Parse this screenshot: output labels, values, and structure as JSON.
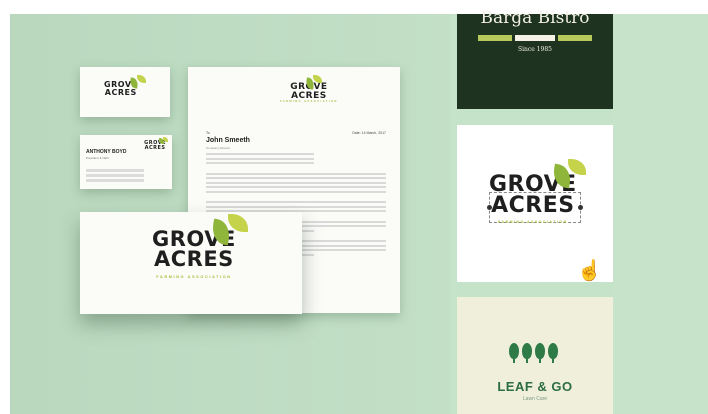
{
  "brand": {
    "name_line1": "GROVE",
    "name_line2": "ACRES",
    "tagline": "FARMING ASSOCIATION"
  },
  "business_card_back": {
    "name": "ANTHONY BOYD",
    "title": "President & CEO"
  },
  "letterhead": {
    "to_label": "To",
    "date": "Date: 14 March, 2017",
    "recipient": "John Smeeth",
    "recipient_role": "Company Director"
  },
  "templates": [
    {
      "title": "Barga Bistro",
      "subtitle": "Since 1985"
    },
    {
      "title": "GROVE ACRES"
    },
    {
      "title": "LEAF & GO",
      "subtitle": "Lawn Care"
    }
  ],
  "colors": {
    "background": "#c5e3c9",
    "leaf_light": "#c4d34a",
    "leaf_dark": "#8fb53a",
    "bistro_bg": "#1e3320",
    "leafgo_green": "#2e7b48"
  },
  "icons": {
    "cursor": "pointer-hand-icon"
  }
}
